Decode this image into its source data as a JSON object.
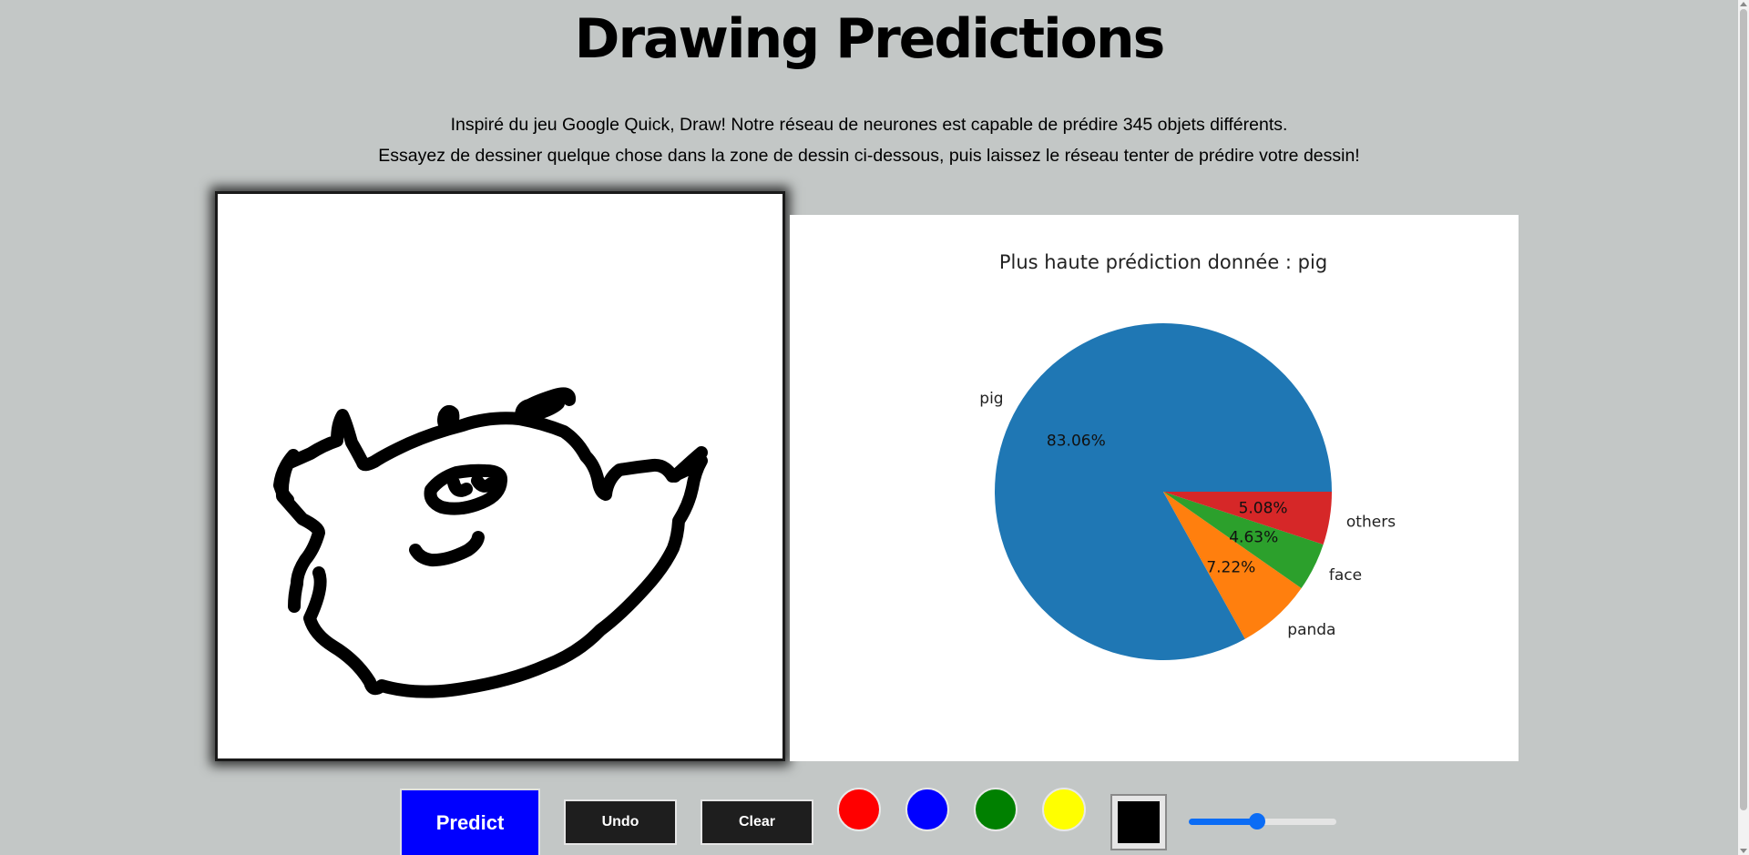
{
  "header": {
    "title": "Drawing Predictions",
    "intro_line1": "Inspiré du jeu Google Quick, Draw! Notre réseau de neurones est capable de prédire 345 objets différents.",
    "intro_line2": "Essayez de dessiner quelque chose dans la zone de dessin ci-dessous, puis laissez le réseau tenter de prédire votre dessin!"
  },
  "drawing": {
    "stroke_color": "#000000",
    "background": "#ffffff"
  },
  "chart_data": {
    "type": "pie",
    "title": "Plus haute prédiction donnée : pig",
    "slices": [
      {
        "label": "pig",
        "value": 83.06,
        "pct_label": "83.06%",
        "color": "#1f77b4"
      },
      {
        "label": "panda",
        "value": 7.22,
        "pct_label": "7.22%",
        "color": "#ff7f0e"
      },
      {
        "label": "face",
        "value": 4.63,
        "pct_label": "4.63%",
        "color": "#2ca02c"
      },
      {
        "label": "others",
        "value": 5.08,
        "pct_label": "5.08%",
        "color": "#d62728"
      }
    ],
    "start_angle_deg": 0,
    "direction": "counterclockwise"
  },
  "toolbar": {
    "predict_label": "Predict",
    "undo_label": "Undo",
    "clear_label": "Clear",
    "colors": [
      "#ff0000",
      "#0000ff",
      "#008000",
      "#ffff00"
    ],
    "current_color": "#000000",
    "brush_size_fraction": 0.46,
    "accent": "#0b6cf5"
  }
}
